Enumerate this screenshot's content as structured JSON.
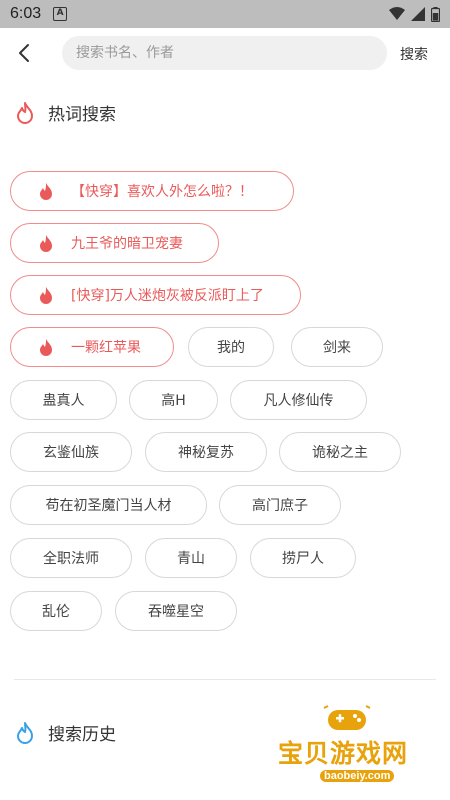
{
  "status_bar": {
    "time": "6:03",
    "badge": "A"
  },
  "search": {
    "placeholder": "搜索书名、作者",
    "button_label": "搜索"
  },
  "hot_section": {
    "title": "热词搜索"
  },
  "hot_tags": [
    "【快穿】喜欢人外怎么啦？！",
    "九王爷的暗卫宠妻",
    "[快穿]万人迷炮灰被反派盯上了",
    "一颗红苹果"
  ],
  "tags": [
    "我的",
    "剑来",
    "蛊真人",
    "高H",
    "凡人修仙传",
    "玄鉴仙族",
    "神秘复苏",
    "诡秘之主",
    "苟在初圣魔门当人材",
    "高门庶子",
    "全职法师",
    "青山",
    "捞尸人",
    "乱伦",
    "吞噬星空"
  ],
  "history_section": {
    "title": "搜索历史"
  },
  "watermark": {
    "text": "宝贝游戏网",
    "url": "baobeiy.com"
  },
  "colors": {
    "hot_accent": "#ea5a5a",
    "history_accent": "#3aa0e8",
    "watermark": "#e8a20c"
  },
  "icons": {
    "back": "chevron-left-icon",
    "hot": "fire-icon",
    "history": "fire-icon"
  }
}
